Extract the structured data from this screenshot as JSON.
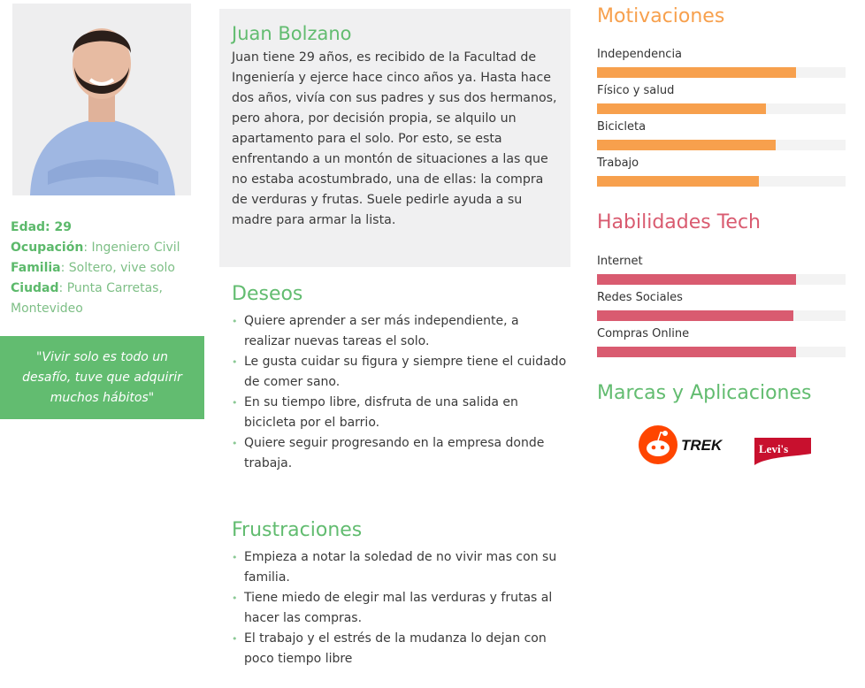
{
  "profile": {
    "name": "Juan Bolzano",
    "bio": "Juan tiene 29 años, es recibido de la Facultad de Ingeniería y ejerce hace cinco años ya. Hasta hace dos años, vivía con sus padres y sus dos hermanos, pero ahora, por decisión propia, se alquilo un apartamento para el solo. Por esto, se esta enfrentando a un montón de situaciones a las que no estaba acostumbrado, una de ellas: la compra de verduras y frutas. Suele pedirle ayuda a su madre para armar la lista.",
    "stats": {
      "age_label": "Edad: 29",
      "occupation_key": "Ocupación",
      "occupation_val": ": Ingeniero Civil",
      "family_key": "Familia",
      "family_val": ": Soltero, vive solo",
      "city_key": "Ciudad",
      "city_val": ": Punta Carretas, Montevideo"
    },
    "quote": "\"Vivir solo es todo un desafío, tuve que adquirir muchos hábitos\""
  },
  "deseos": {
    "title": "Deseos",
    "items": [
      "Quiere aprender a ser más independiente, a realizar nuevas tareas el solo.",
      "Le gusta cuidar su figura y siempre tiene el cuidado de comer sano.",
      "En su tiempo libre, disfruta de una salida en bicicleta por el barrio.",
      "Quiere seguir progresando en la empresa donde trabaja."
    ]
  },
  "frustraciones": {
    "title": "Frustraciones",
    "items": [
      "Empieza a notar la soledad de no vivir mas con su familia.",
      "Tiene miedo de elegir mal las verduras y  frutas al hacer las compras.",
      "El trabajo y el estrés de la mudanza lo dejan con poco tiempo libre"
    ]
  },
  "motivaciones": {
    "title": "Motivaciones",
    "color": "#f7a04d",
    "bars": [
      {
        "label": "Independencia",
        "value": 0.8
      },
      {
        "label": "Físico y salud",
        "value": 0.68
      },
      {
        "label": "Bicicleta",
        "value": 0.72
      },
      {
        "label": "Trabajo",
        "value": 0.65
      }
    ]
  },
  "habilidades": {
    "title": "Habilidades Tech",
    "color": "#d95b70",
    "bars": [
      {
        "label": "Internet",
        "value": 0.8
      },
      {
        "label": "Redes Sociales",
        "value": 0.79
      },
      {
        "label": "Compras Online",
        "value": 0.8
      }
    ]
  },
  "marcas": {
    "title": "Marcas y Aplicaciones",
    "brands": [
      "TREK",
      "Levi's"
    ]
  }
}
